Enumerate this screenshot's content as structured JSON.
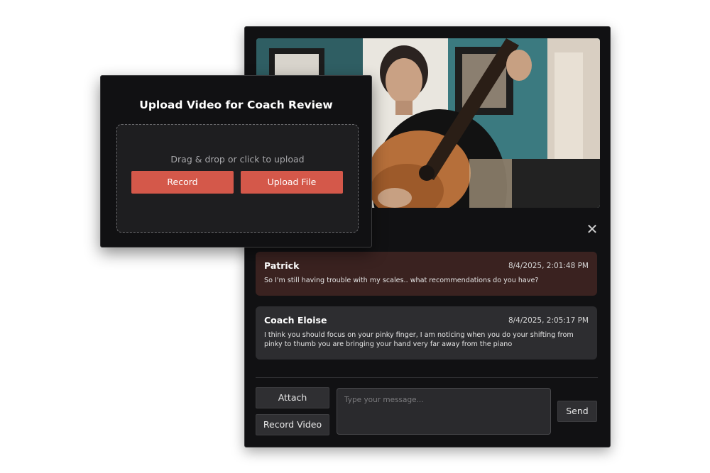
{
  "upload": {
    "title": "Upload Video for Coach Review",
    "drop_text": "Drag & drop or click to upload",
    "record_label": "Record",
    "upload_label": "Upload File"
  },
  "chat": {
    "close_icon": "close-icon",
    "messages": [
      {
        "sender": "Patrick",
        "time": "8/4/2025, 2:01:48 PM",
        "text": "So I'm still having trouble with my scales.. what recommendations do you have?"
      },
      {
        "sender": "Coach Eloise",
        "time": "8/4/2025, 2:05:17 PM",
        "text": "I think you should focus on your pinky finger, I am noticing when you do your shifting from pinky to thumb you are bringing your hand very far away from the piano"
      }
    ],
    "attach_label": "Attach",
    "record_video_label": "Record Video",
    "input_placeholder": "Type your message...",
    "send_label": "Send"
  },
  "colors": {
    "accent": "#d4584a",
    "panel_bg": "#111113",
    "patrick_msg_bg": "#3a2220",
    "coach_msg_bg": "#2d2d30"
  }
}
